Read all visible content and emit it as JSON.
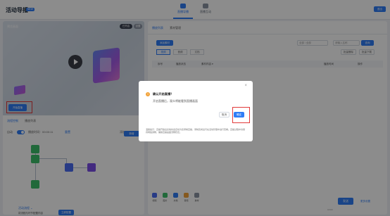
{
  "app": {
    "title": "活动导播",
    "badge": "NEW"
  },
  "top_tabs": [
    {
      "label": "直播导播",
      "active": true
    },
    {
      "label": "直播互动",
      "active": false
    }
  ],
  "header": {
    "exit_label": "退出"
  },
  "video": {
    "label": "预览画面",
    "pill_1": "已开启",
    "pill_2": "设置",
    "start_live_label": "开始直播"
  },
  "flow": {
    "tabs": [
      "流程控制",
      "播放列表"
    ],
    "toggle_label": "自动",
    "time_label": "播放时间：00:00:11",
    "link_label": "重置",
    "right_label": "添加",
    "btn_label": "新增",
    "bottom_link": "活动流程 ⌄",
    "bottom_text": "将流程与环节配置内容",
    "bottom_btn": "立即配置"
  },
  "right_panel": {
    "tabs": [
      "播放列表",
      "素材管理"
    ],
    "add_button": "添加素材",
    "filter_placeholder": "全部 / 全部",
    "search_placeholder": "请输入名称",
    "search_button": "查询",
    "segments": [
      "视频",
      "音频",
      "文档"
    ],
    "upload_button": "批量删除",
    "clear_button": "批量下载",
    "table_headers": [
      "序号",
      "播放状态",
      "素材内容 ▾",
      "播放时间",
      "操作"
    ],
    "tools": [
      "视频",
      "图片",
      "文档",
      "音频",
      "素材"
    ],
    "send_button": "发送",
    "send_more": "更多设置",
    "count": "0/100"
  },
  "modal": {
    "title": "确认开启直播？",
    "message": "开启直播后，观众将能看到直播画面",
    "cancel": "取消",
    "confirm": "确定",
    "note": "温馨提示：直播开始后系统将会自动为您录制直播，录制完成后可在活动管理中进行查看。直播过程中请保持网络通畅，确保直播画面流畅稳定。"
  }
}
